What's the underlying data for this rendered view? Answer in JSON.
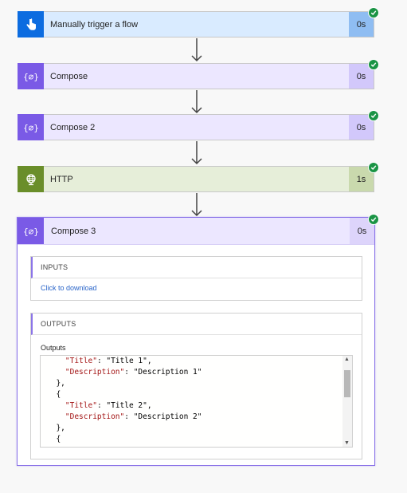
{
  "steps": [
    {
      "title": "Manually trigger a flow",
      "duration": "0s",
      "icon": "touch-hand-icon"
    },
    {
      "title": "Compose",
      "duration": "0s",
      "icon": "compose-braces-icon"
    },
    {
      "title": "Compose 2",
      "duration": "0s",
      "icon": "compose-braces-icon"
    },
    {
      "title": "HTTP",
      "duration": "1s",
      "icon": "globe-icon"
    }
  ],
  "expanded": {
    "title": "Compose 3",
    "duration": "0s",
    "icon": "compose-braces-icon",
    "inputs_label": "INPUTS",
    "download_link": "Click to download",
    "outputs_label": "OUTPUTS",
    "outputs_field": "Outputs",
    "code_lines": [
      "    \"Title\": \"Title 1\",",
      "    \"Description\": \"Description 1\"",
      "  },",
      "  {",
      "    \"Title\": \"Title 2\",",
      "    \"Description\": \"Description 2\"",
      "  },",
      "  {"
    ]
  },
  "colors": {
    "success": "#1a9445",
    "trigger": "#0c6ce0",
    "compose": "#7a5ae6",
    "http": "#6a8e2a"
  }
}
